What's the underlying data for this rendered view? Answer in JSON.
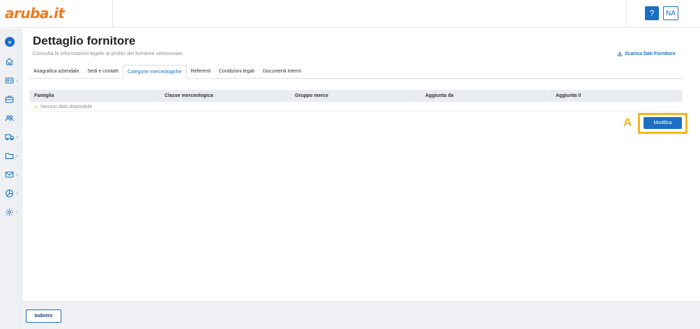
{
  "header": {
    "logo_text": "aruba.it",
    "help_label": "?",
    "avatar_initials": "NA"
  },
  "sidebar": {
    "expand_icon": "double-chevron-right-icon",
    "items": [
      {
        "icon": "home-icon",
        "has_children": false
      },
      {
        "icon": "id-card-icon",
        "has_children": true
      },
      {
        "icon": "briefcase-icon",
        "has_children": false
      },
      {
        "icon": "users-icon",
        "has_children": false
      },
      {
        "icon": "truck-icon",
        "has_children": true
      },
      {
        "icon": "folder-icon",
        "has_children": true
      },
      {
        "icon": "mail-icon",
        "has_children": true
      },
      {
        "icon": "chart-pie-icon",
        "has_children": true
      },
      {
        "icon": "gear-icon",
        "has_children": true
      }
    ],
    "chevron": "›"
  },
  "page": {
    "title": "Dettaglio fornitore",
    "subtitle": "Consulta le informazioni legate al profilo del fornitore selezionato",
    "download_label": "Scarica Dati Fornitore"
  },
  "tabs": [
    {
      "label": "Anagrafica aziendale",
      "active": false
    },
    {
      "label": "Sedi e contatti",
      "active": false
    },
    {
      "label": "Categorie merceologiche",
      "active": true
    },
    {
      "label": "Referenti",
      "active": false
    },
    {
      "label": "Condizioni legali",
      "active": false
    },
    {
      "label": "Documenti Interni",
      "active": false
    }
  ],
  "table": {
    "columns": [
      "Famiglia",
      "Classe merceologica",
      "Gruppo merce",
      "Aggiunta da",
      "Aggiunta il"
    ],
    "empty_message": "Nessun dato disponibile"
  },
  "actions": {
    "edit_label": "Modifica",
    "highlight_label": "A",
    "back_label": "Indietro"
  },
  "colors": {
    "accent": "#1a6fc2",
    "highlight": "#f2b71a",
    "brand": "#f07a1a"
  }
}
